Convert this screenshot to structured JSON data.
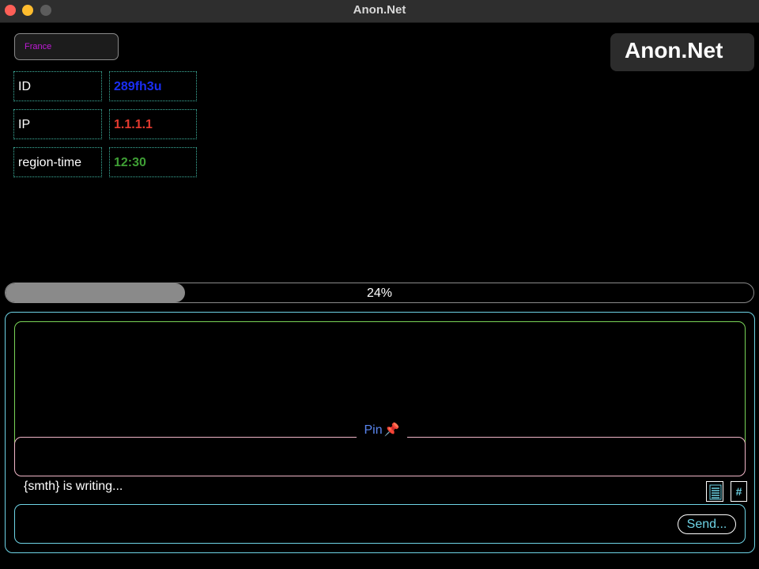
{
  "window": {
    "title": "Anon.Net"
  },
  "country_select": {
    "value": "France"
  },
  "brand": {
    "label": "Anon.Net"
  },
  "info_table": {
    "rows": [
      {
        "key": "ID",
        "value": "289fh3u",
        "color": "#1a2ef5"
      },
      {
        "key": "IP",
        "value": "1.1.1.1",
        "color": "#e53a2f"
      },
      {
        "key": "region-time",
        "value": "12:30",
        "color": "#3f9f35"
      }
    ]
  },
  "progress": {
    "value": 0.24,
    "label": "24%"
  },
  "chat": {
    "pin_label": "Pin",
    "pin_icon": "pushpin-icon",
    "typing_status": "{smth} is writing...",
    "message_input": {
      "value": "",
      "placeholder": ""
    },
    "send_label": "Send...",
    "hash_label": "#",
    "list_icon": "list-icon"
  },
  "colors": {
    "background": "#000000",
    "accent_cyan": "#6ed4e6",
    "accent_green": "#79d457",
    "accent_pink": "#f0b6c7",
    "pin_text": "#5a86f0",
    "country_text": "#c01ad8"
  }
}
